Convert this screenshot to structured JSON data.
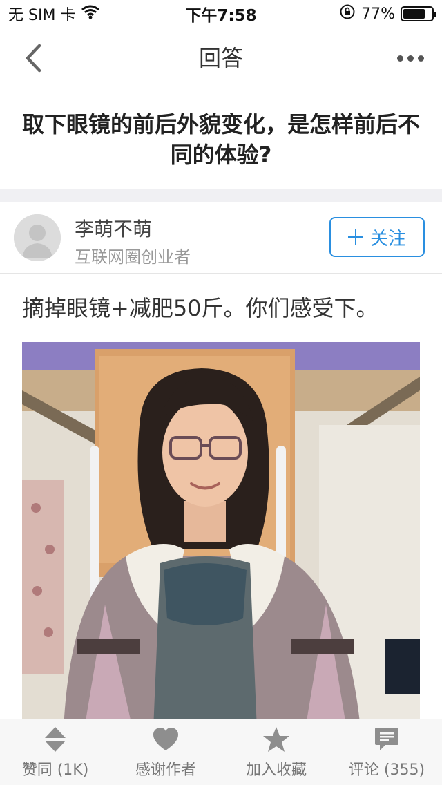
{
  "status_bar": {
    "carrier": "无 SIM 卡",
    "time": "下午7:58",
    "battery_percent": "77%",
    "battery_level": 0.77,
    "icons": [
      "wifi-icon",
      "orientation-lock-icon",
      "battery-icon"
    ]
  },
  "nav": {
    "title": "回答",
    "icons": [
      "back-chevron-icon",
      "more-dots-icon"
    ]
  },
  "question": {
    "title": "取下眼镜的前后外貌变化，是怎样前后不同的体验?"
  },
  "author": {
    "name": "李萌不萌",
    "bio": "互联网圈创业者",
    "follow_label": "关注"
  },
  "answer": {
    "text": "摘掉眼镜+减肥50斤。你们感受下。"
  },
  "toolbar": {
    "items": [
      {
        "label": "赞同 (1K)",
        "icon": "vote-arrows-icon"
      },
      {
        "label": "感谢作者",
        "icon": "heart-icon"
      },
      {
        "label": "加入收藏",
        "icon": "star-icon"
      },
      {
        "label": "评论 (355)",
        "icon": "comment-icon"
      }
    ]
  },
  "colors": {
    "accent": "#2a8fe0",
    "divider_band": "#f0f0f3",
    "toolbar_bg": "#f7f7f7",
    "icon_gray": "#8e8e8e"
  }
}
